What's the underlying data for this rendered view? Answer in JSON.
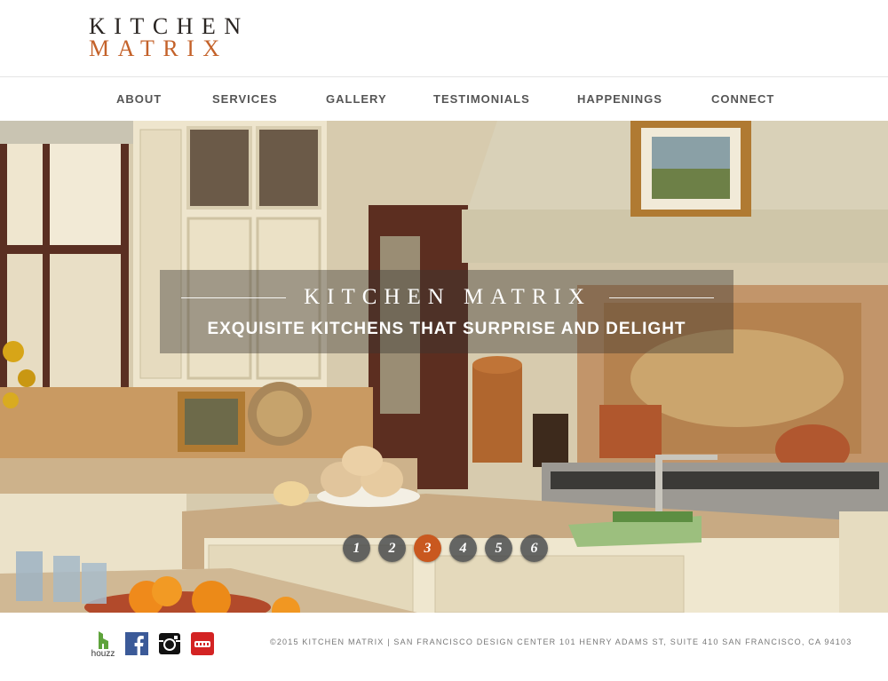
{
  "brand": {
    "top": "KITCHEN",
    "bottom": "MATRIX",
    "colors": {
      "dark": "#2a2522",
      "accent": "#c4622a"
    }
  },
  "nav": {
    "items": [
      {
        "label": "ABOUT"
      },
      {
        "label": "SERVICES"
      },
      {
        "label": "GALLERY"
      },
      {
        "label": "TESTIMONIALS"
      },
      {
        "label": "HAPPENINGS"
      },
      {
        "label": "CONNECT"
      }
    ]
  },
  "hero": {
    "title": "KITCHEN MATRIX",
    "subtitle": "EXQUISITE KITCHENS THAT SURPRISE AND DELIGHT",
    "slides": [
      "1",
      "2",
      "3",
      "4",
      "5",
      "6"
    ],
    "active_slide": "3",
    "active_color": "#c9581f"
  },
  "footer": {
    "social": [
      {
        "name": "houzz-icon",
        "label": "houzz"
      },
      {
        "name": "facebook-icon"
      },
      {
        "name": "instagram-icon"
      },
      {
        "name": "yelp-icon"
      }
    ],
    "copyright": "©2015 KITCHEN MATRIX | SAN FRANCISCO DESIGN CENTER 101 HENRY ADAMS ST, SUITE 410 SAN FRANCISCO, CA 94103"
  }
}
